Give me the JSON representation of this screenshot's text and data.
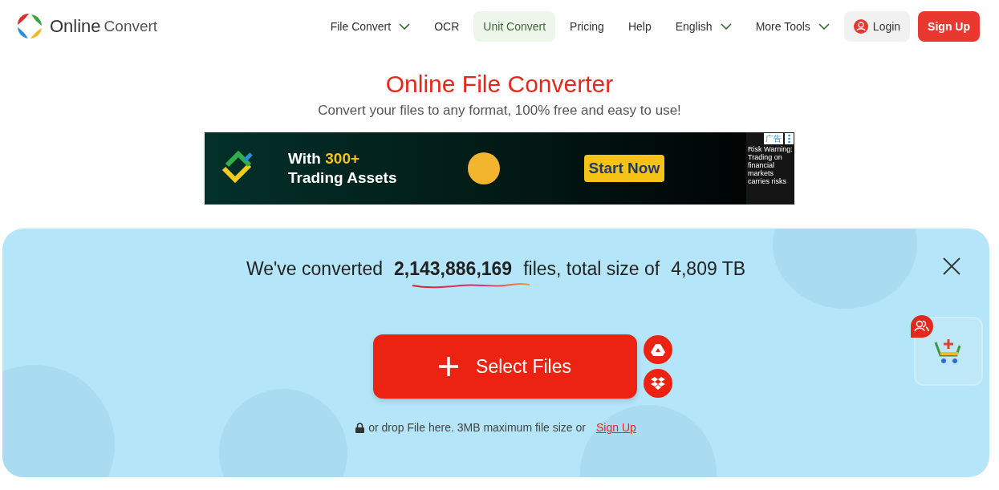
{
  "logo": {
    "word_1": "Online",
    "word_2": "Convert"
  },
  "nav": [
    {
      "label": "File Convert",
      "has_menu": true,
      "selected": false
    },
    {
      "label": "OCR",
      "has_menu": false,
      "selected": false
    },
    {
      "label": "Unit Convert",
      "has_menu": false,
      "selected": true
    },
    {
      "label": "Pricing",
      "has_menu": false,
      "selected": false
    },
    {
      "label": "Help",
      "has_menu": false,
      "selected": false
    },
    {
      "label": "English",
      "has_menu": true,
      "selected": false
    },
    {
      "label": "More Tools",
      "has_menu": true,
      "selected": false
    }
  ],
  "login": "Login",
  "signup": "Sign Up",
  "title": "Online File Converter",
  "subtitle": "Convert your files to any format, 100% free and easy to use!",
  "ad": {
    "line_1_prefix": "With",
    "line_1_highlight": "300+",
    "line_2": "Trading Assets",
    "cta": "Start Now",
    "badge": "广告",
    "warning": "Risk Warning: Trading on financial markets carries risks"
  },
  "stats": {
    "prefix": "We've converted",
    "count": "2,143,886,169",
    "middle": "files, total size of",
    "size": "4,809 TB"
  },
  "select_button": "Select Files",
  "drop_hint": "or drop File here. 3MB maximum file size or",
  "drop_link": "Sign Up"
}
